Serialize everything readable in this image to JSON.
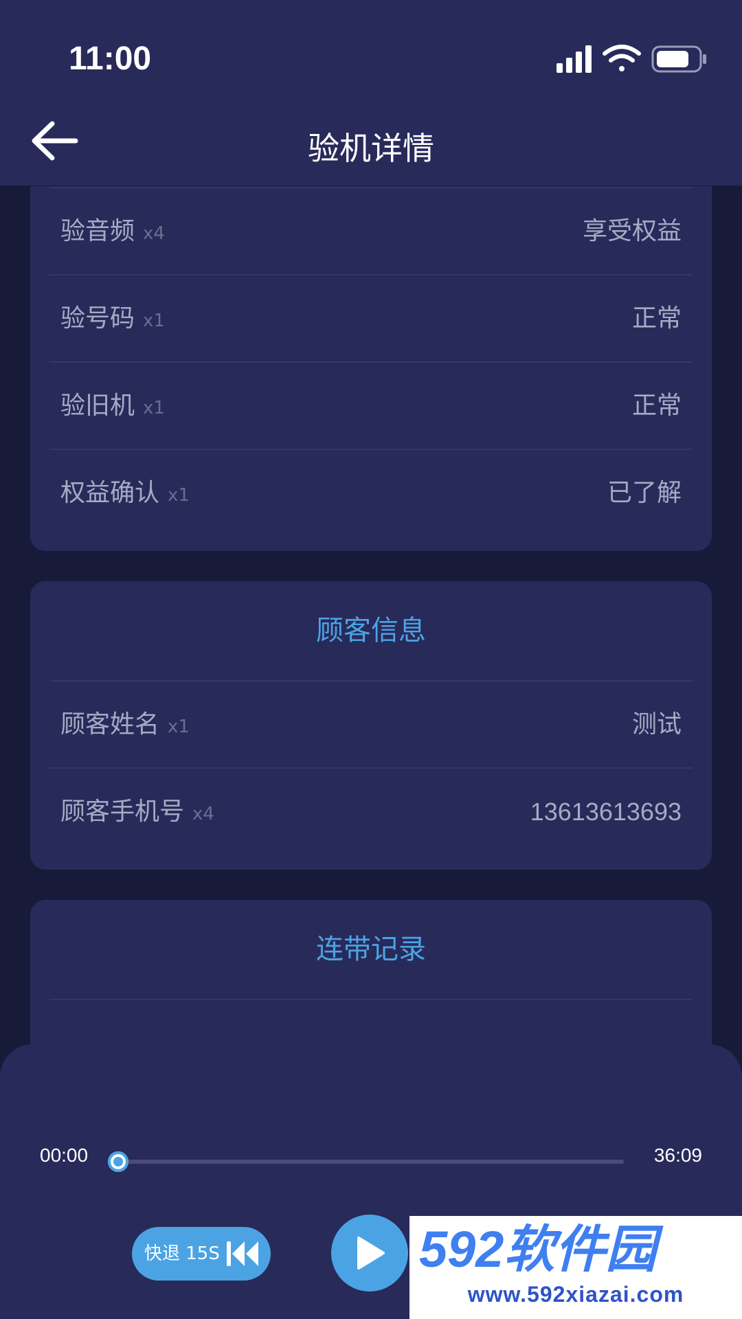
{
  "status_bar": {
    "time": "11:00"
  },
  "nav": {
    "title": "验机详情"
  },
  "inspection": {
    "rows": [
      {
        "label": "验音频",
        "mult": "x4",
        "value": "享受权益"
      },
      {
        "label": "验号码",
        "mult": "x1",
        "value": "正常"
      },
      {
        "label": "验旧机",
        "mult": "x1",
        "value": "正常"
      },
      {
        "label": "权益确认",
        "mult": "x1",
        "value": "已了解"
      }
    ]
  },
  "customer": {
    "title": "顾客信息",
    "rows": [
      {
        "label": "顾客姓名",
        "mult": "x1",
        "value": "测试"
      },
      {
        "label": "顾客手机号",
        "mult": "x4",
        "value": "13613613693"
      }
    ]
  },
  "bundle": {
    "title": "连带记录"
  },
  "player": {
    "current_time": "00:00",
    "total_time": "36:09",
    "progress": 0.0,
    "rewind_label": "快退 15S"
  },
  "watermark": {
    "logo_text": "592软件园",
    "url": "www.592xiazai.com"
  },
  "colors": {
    "accent": "#4ba3e3",
    "card": "#282a5a",
    "background": "#181a3a"
  },
  "icons": [
    "back-arrow-icon",
    "signal-icon",
    "wifi-icon",
    "battery-icon",
    "rewind-icon",
    "play-icon"
  ]
}
